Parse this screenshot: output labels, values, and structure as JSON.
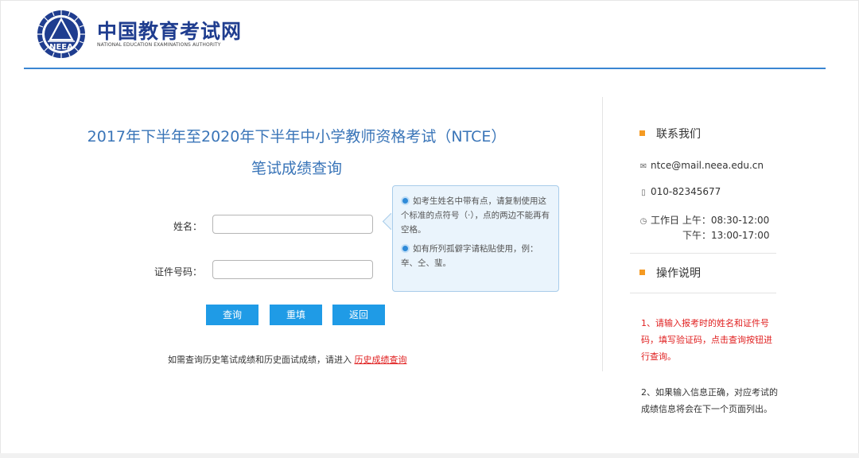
{
  "header": {
    "logo_text": "NEEA",
    "title": "中国教育考试网",
    "subtitle": "NATIONAL EDUCATION EXAMINATIONS AUTHORITY"
  },
  "main": {
    "title": "2017年下半年至2020年下半年中小学教师资格考试（NTCE）",
    "subtitle": "笔试成绩查询",
    "name_label": "姓名：",
    "name_value": "",
    "id_label": "证件号码：",
    "id_value": "",
    "tip1": "如考生姓名中带有点，请复制使用这个标准的点符号（·），点的两边不能再有空格。",
    "tip2": "如有所列孤僻字请粘贴使用，例：㚔、仝、㻗。",
    "buttons": {
      "query": "查询",
      "reset": "重填",
      "back": "返回"
    },
    "history_text": "如需查询历史笔试成绩和历史面试成绩，请进入",
    "history_link": "历史成绩查询"
  },
  "contact": {
    "title": "联系我们",
    "email": "ntce@mail.neea.edu.cn",
    "phone": "010-82345677",
    "hours_line1": "工作日 上午：08:30-12:00",
    "hours_line2": "下午：13:00-17:00"
  },
  "instructions": {
    "title": "操作说明",
    "item1": "1、请输入报考时的姓名和证件号码，填写验证码，点击查询按钮进行查询。",
    "item2": "2、如果输入信息正确，对应考试的成绩信息将会在下一个页面列出。"
  },
  "colors": {
    "accent_blue": "#1f9be6",
    "title_blue": "#3a75b8",
    "brand_navy": "#1f3d8f",
    "link_red": "#e02020",
    "bullet_orange": "#f59a22"
  },
  "icons": {
    "logo": "neea-logo",
    "email": "envelope-icon",
    "phone": "phone-icon",
    "clock": "clock-icon",
    "tip": "radio-dot-icon"
  }
}
